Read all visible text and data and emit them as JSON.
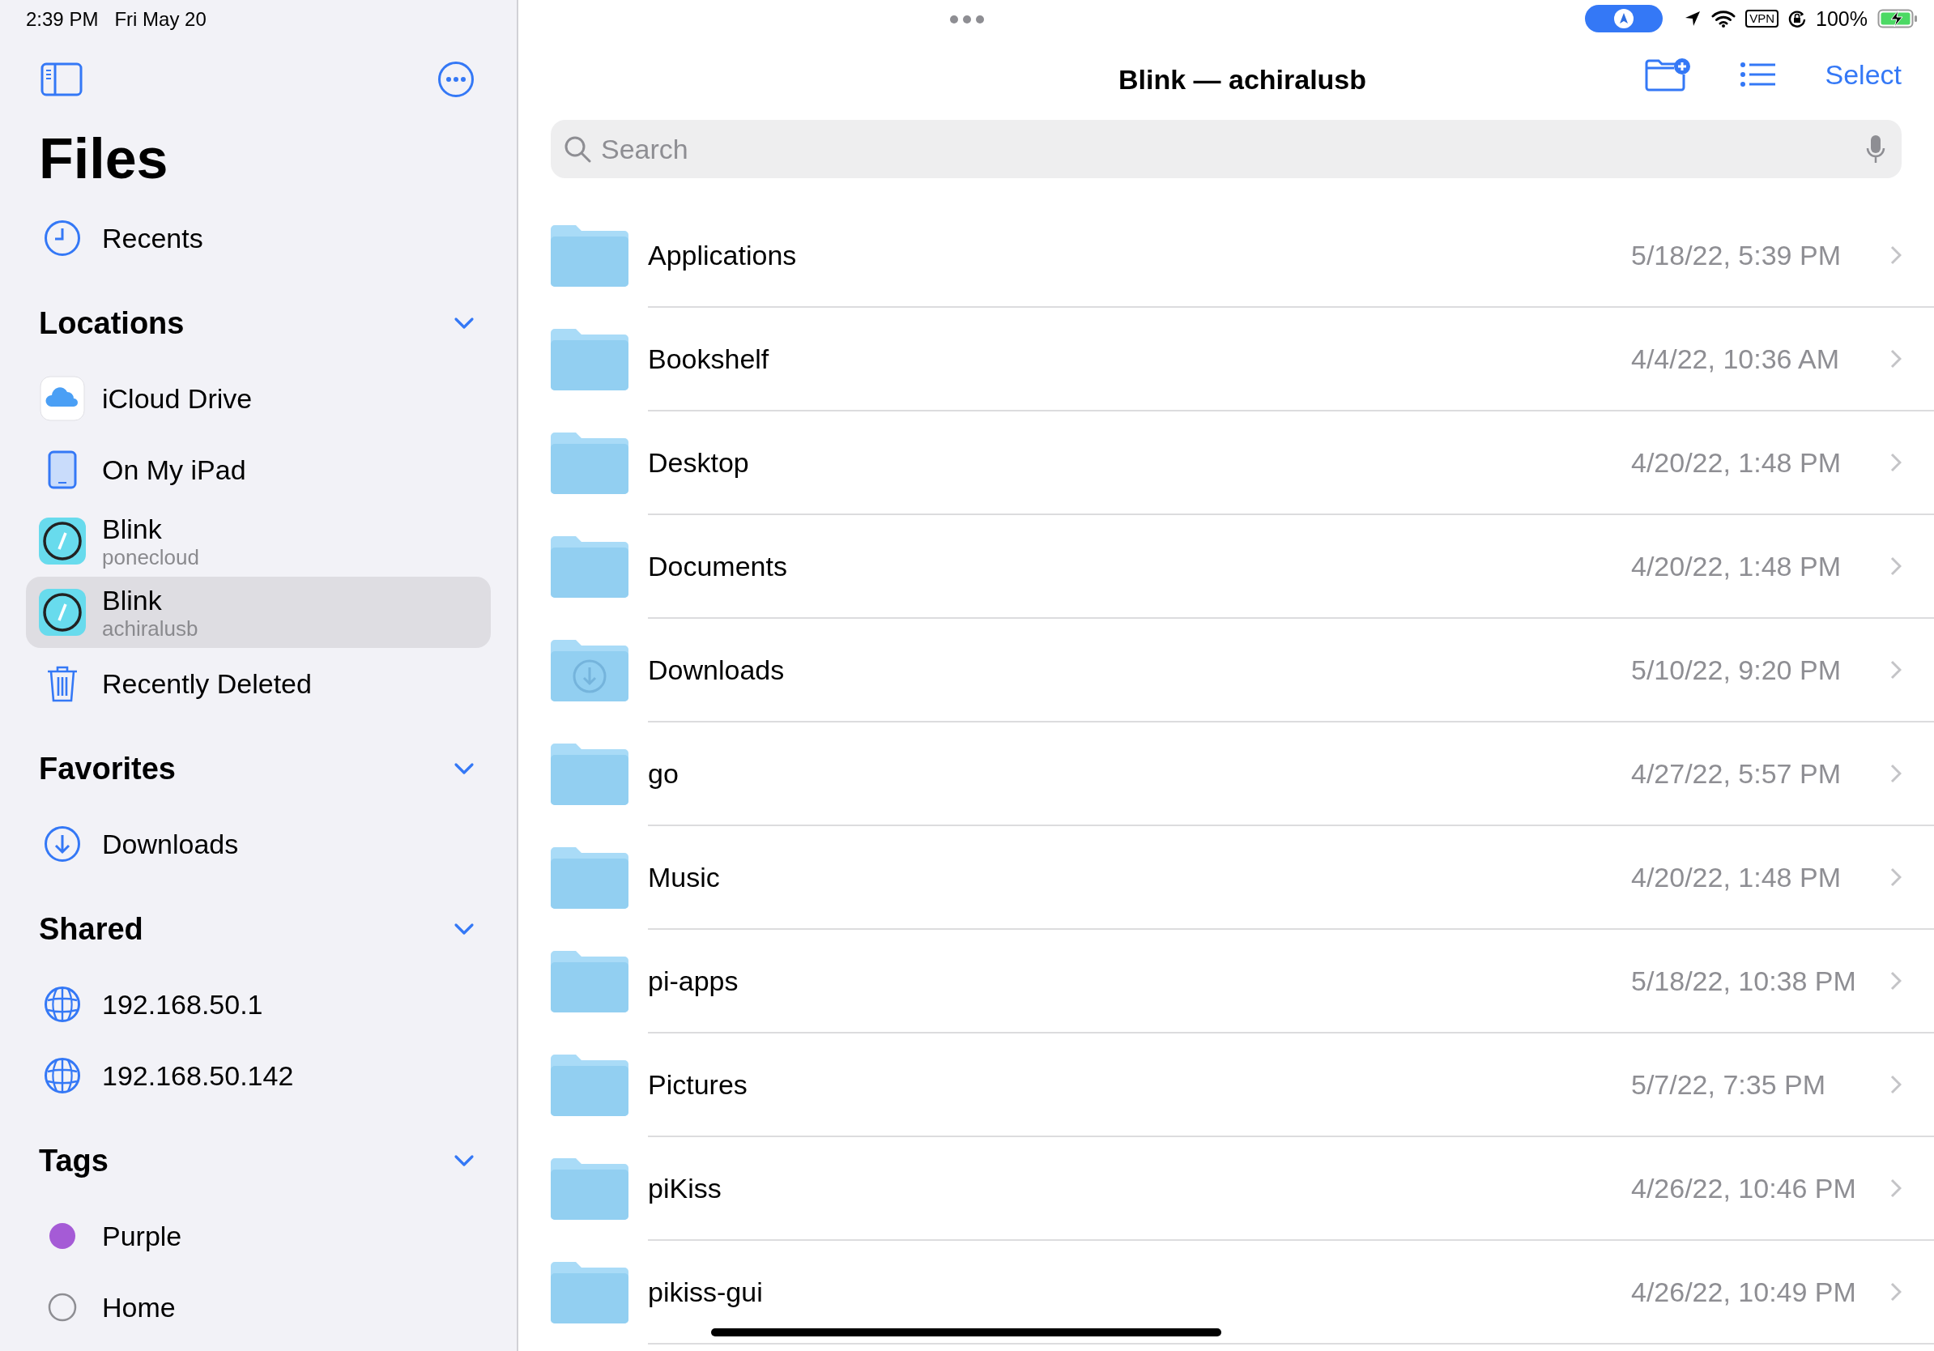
{
  "status_bar": {
    "time": "2:39 PM",
    "date": "Fri May 20",
    "vpn": "VPN",
    "battery": "100%"
  },
  "sidebar": {
    "title": "Files",
    "top_items": [
      {
        "label": "Recents",
        "kind": "clock",
        "selected": false
      }
    ],
    "sections": [
      {
        "title": "Locations",
        "expanded": true,
        "items": [
          {
            "label": "iCloud Drive",
            "kind": "cloud",
            "selected": false
          },
          {
            "label": "On My iPad",
            "kind": "ipad",
            "selected": false
          },
          {
            "label": "Blink",
            "subtitle": "ponecloud",
            "kind": "blink",
            "selected": false
          },
          {
            "label": "Blink",
            "subtitle": "achiralusb",
            "kind": "blink",
            "selected": true
          },
          {
            "label": "Recently Deleted",
            "kind": "trash",
            "selected": false
          }
        ]
      },
      {
        "title": "Favorites",
        "expanded": true,
        "items": [
          {
            "label": "Downloads",
            "kind": "download",
            "selected": false
          }
        ]
      },
      {
        "title": "Shared",
        "expanded": true,
        "items": [
          {
            "label": "192.168.50.1",
            "kind": "globe",
            "selected": false
          },
          {
            "label": "192.168.50.142",
            "kind": "globe",
            "selected": false
          }
        ]
      },
      {
        "title": "Tags",
        "expanded": true,
        "items": [
          {
            "label": "Purple",
            "kind": "tag",
            "color": "#a55bd6",
            "selected": false
          },
          {
            "label": "Home",
            "kind": "tag-outline",
            "color": "#8e8e93",
            "selected": false
          }
        ]
      }
    ]
  },
  "main": {
    "title": "Blink — achiralusb",
    "select": "Select",
    "search": {
      "placeholder": "Search"
    },
    "folders": [
      {
        "name": "Applications",
        "date": "5/18/22, 5:39 PM",
        "kind": "plain"
      },
      {
        "name": "Bookshelf",
        "date": "4/4/22, 10:36 AM",
        "kind": "plain"
      },
      {
        "name": "Desktop",
        "date": "4/20/22, 1:48 PM",
        "kind": "plain"
      },
      {
        "name": "Documents",
        "date": "4/20/22, 1:48 PM",
        "kind": "plain"
      },
      {
        "name": "Downloads",
        "date": "5/10/22, 9:20 PM",
        "kind": "downloads"
      },
      {
        "name": "go",
        "date": "4/27/22, 5:57 PM",
        "kind": "plain"
      },
      {
        "name": "Music",
        "date": "4/20/22, 1:48 PM",
        "kind": "plain"
      },
      {
        "name": "pi-apps",
        "date": "5/18/22, 10:38 PM",
        "kind": "plain"
      },
      {
        "name": "Pictures",
        "date": "5/7/22, 7:35 PM",
        "kind": "plain"
      },
      {
        "name": "piKiss",
        "date": "4/26/22, 10:46 PM",
        "kind": "plain"
      },
      {
        "name": "pikiss-gui",
        "date": "4/26/22, 10:49 PM",
        "kind": "plain"
      }
    ]
  }
}
